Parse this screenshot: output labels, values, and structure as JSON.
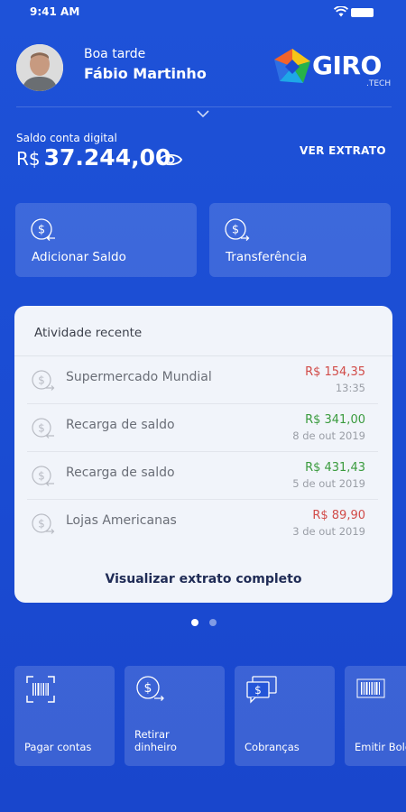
{
  "status_bar": {
    "time": "9:41 AM"
  },
  "header": {
    "greeting": "Boa tarde",
    "user_name": "Fábio Martinho"
  },
  "logo": {
    "word": "GIRO",
    "sub": ".TECH",
    "colors": [
      "#f5c518",
      "#27b24a",
      "#1ea7e8",
      "#f2632a"
    ]
  },
  "balance": {
    "label": "Saldo conta digital",
    "currency": "R$",
    "value": "37.244,00",
    "statement_button": "VER EXTRATO"
  },
  "actions": [
    {
      "label": "Adicionar Saldo",
      "icon": "dollar-arrow-in-icon"
    },
    {
      "label": "Transferência",
      "icon": "dollar-transfer-icon"
    }
  ],
  "activity": {
    "title": "Atividade recente",
    "items": [
      {
        "name": "Supermercado Mundial",
        "amount": "R$ 154,35",
        "date": "13:35",
        "type": "debit"
      },
      {
        "name": "Recarga de saldo",
        "amount": "R$ 341,00",
        "date": "8 de out 2019",
        "type": "credit"
      },
      {
        "name": "Recarga de saldo",
        "amount": "R$ 431,43",
        "date": "5 de out 2019",
        "type": "credit"
      },
      {
        "name": "Lojas Americanas",
        "amount": "R$ 89,90",
        "date": "3 de out 2019",
        "type": "debit"
      }
    ],
    "view_all": "Visualizar extrato completo"
  },
  "pager": {
    "pages": 2,
    "active": 1
  },
  "services": [
    {
      "label": "Pagar contas",
      "icon": "barcode-scan-icon"
    },
    {
      "label": "Retirar dinheiro",
      "icon": "dollar-withdraw-icon"
    },
    {
      "label": "Cobranças",
      "icon": "charge-messages-icon"
    },
    {
      "label": "Emitir Boleto",
      "icon": "barcode-icon"
    }
  ],
  "colors": {
    "background": "#1a4bd2",
    "debit": "#d14b48",
    "credit": "#3a9b3e",
    "card_bg": "#f1f4fa"
  }
}
